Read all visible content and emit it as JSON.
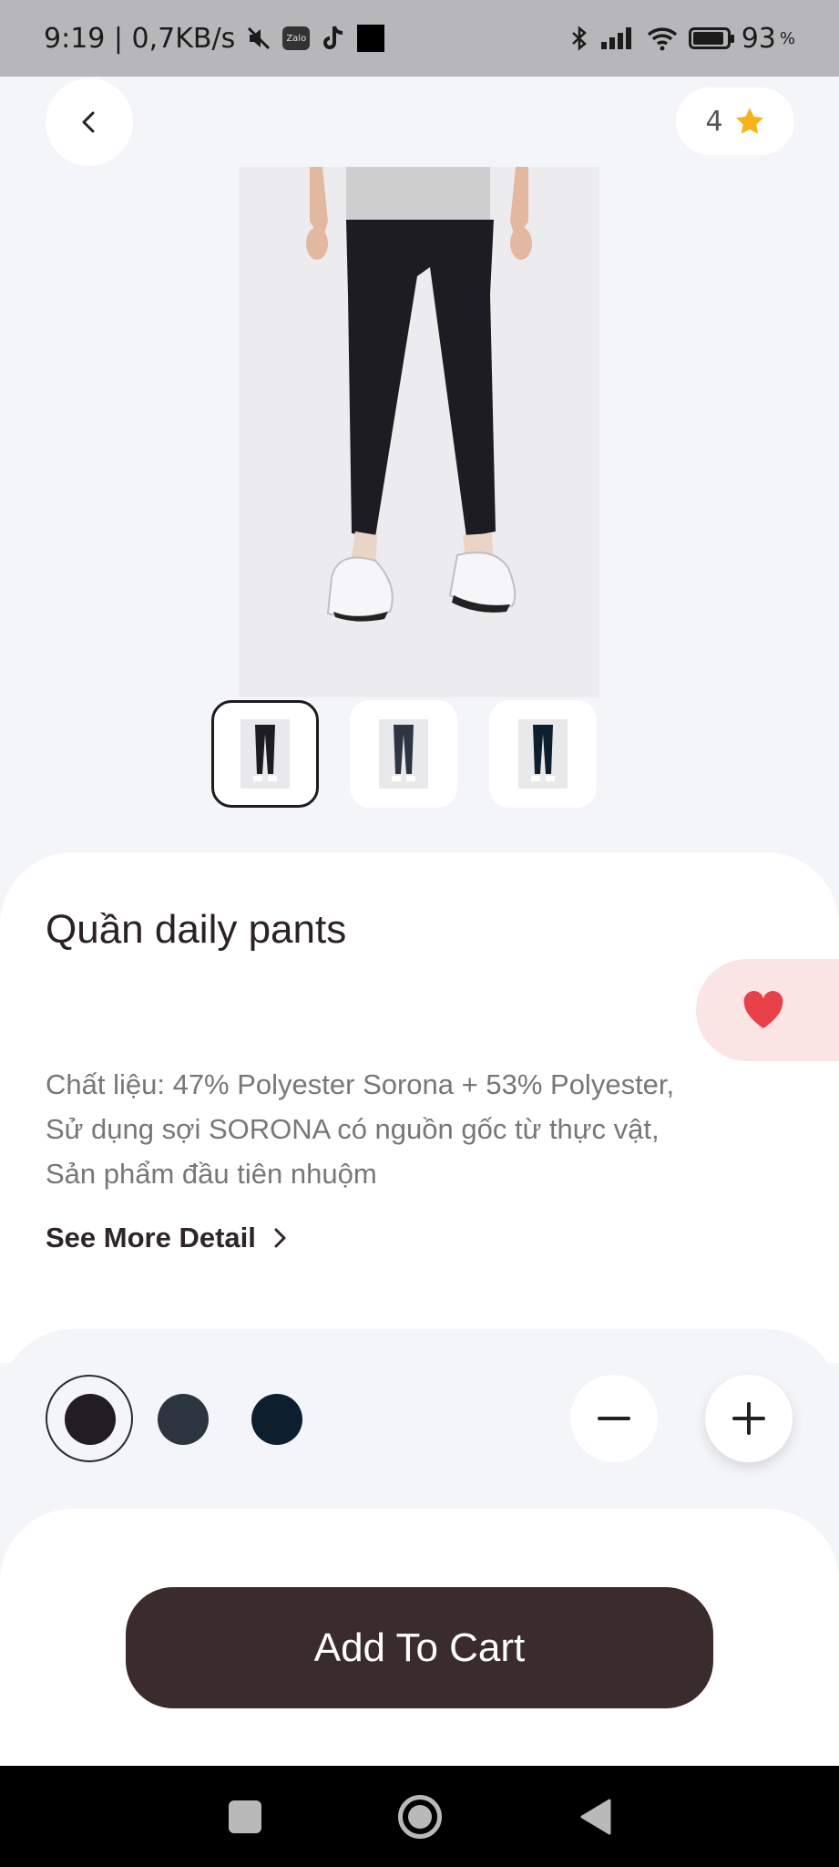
{
  "status_bar": {
    "time_speed": "9:19 | 0,7KB/s",
    "zalo_label": "Zalo",
    "battery_pct": "93",
    "battery_unit": "%"
  },
  "header": {
    "rating_value": "4"
  },
  "product": {
    "title": "Quần daily pants",
    "description": "Chất liệu: 47% Polyester Sorona + 53% Polyester, Sử dụng sợi SORONA có nguồn gốc từ thực vật, Sản phẩm đầu tiên nhuộm",
    "see_more_label": "See More Detail",
    "thumbnails": [
      {
        "selected": true
      },
      {
        "selected": false
      },
      {
        "selected": false
      }
    ],
    "colors": [
      "#221d22",
      "#2d3540",
      "#0d1e2e"
    ],
    "selected_color_index": 0
  },
  "actions": {
    "add_to_cart_label": "Add To Cart"
  },
  "theme": {
    "accent": "#3a2c2c",
    "favorite": "#e84048",
    "favorite_bg": "#fbe4e4",
    "star": "#f6b21b"
  }
}
